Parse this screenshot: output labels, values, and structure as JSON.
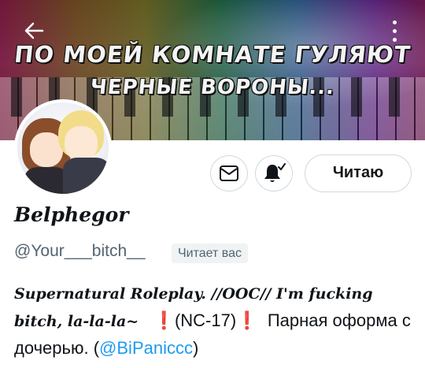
{
  "header": {
    "banner_line_1": "ПО МОЕЙ КОМНАТЕ ГУЛЯЮТ",
    "banner_line_2": "ЧЕРНЫЕ ВОРОНЫ...",
    "back_icon": "arrow-left-icon",
    "more_icon": "vertical-dots-icon"
  },
  "actions": {
    "message_icon": "envelope-icon",
    "notifications_icon": "bell-check-icon",
    "follow_label": "Читаю"
  },
  "profile": {
    "display_name": "Belphegor",
    "username": "@Your___bitch__",
    "follows_you": "Читает вас"
  },
  "bio": {
    "gothic_1": "Supernatural Roleplay. //OOC// I'm fucking bitch, la-la-la~",
    "mark_left": "❗",
    "rating": "(NC-17)",
    "mark_right": "❗",
    "text_2": "Парная оформа с дочерью. (",
    "mention": "@BiPaniccc",
    "text_3": ")"
  },
  "colors": {
    "accent": "#1d9bf0",
    "alert": "#e0245e",
    "secondary_text": "#536471"
  }
}
